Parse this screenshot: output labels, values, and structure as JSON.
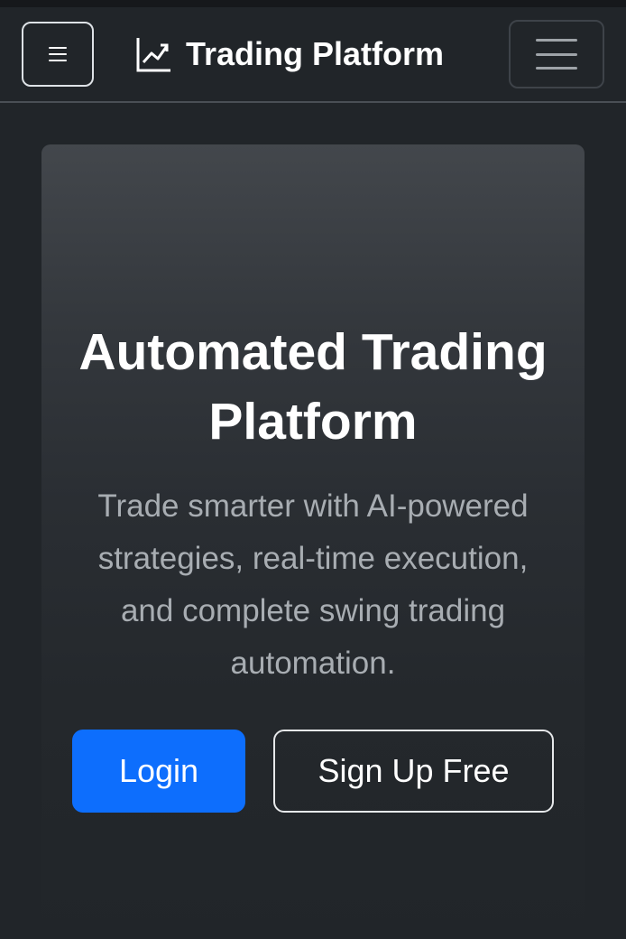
{
  "navbar": {
    "brand_text": "Trading Platform",
    "brand_icon": "graph-up-icon",
    "sidebar_toggle_icon": "list-icon",
    "menu_toggle_icon": "hamburger-menu-icon"
  },
  "hero": {
    "title": "Automated Trading Platform",
    "subtitle": "Trade smarter with AI-powered strategies, real-time execution, and complete swing trading automation.",
    "login_label": "Login",
    "signup_label": "Sign Up Free"
  },
  "colors": {
    "background": "#212529",
    "primary": "#0d6efd",
    "subtitle_text": "#a8adb2"
  }
}
